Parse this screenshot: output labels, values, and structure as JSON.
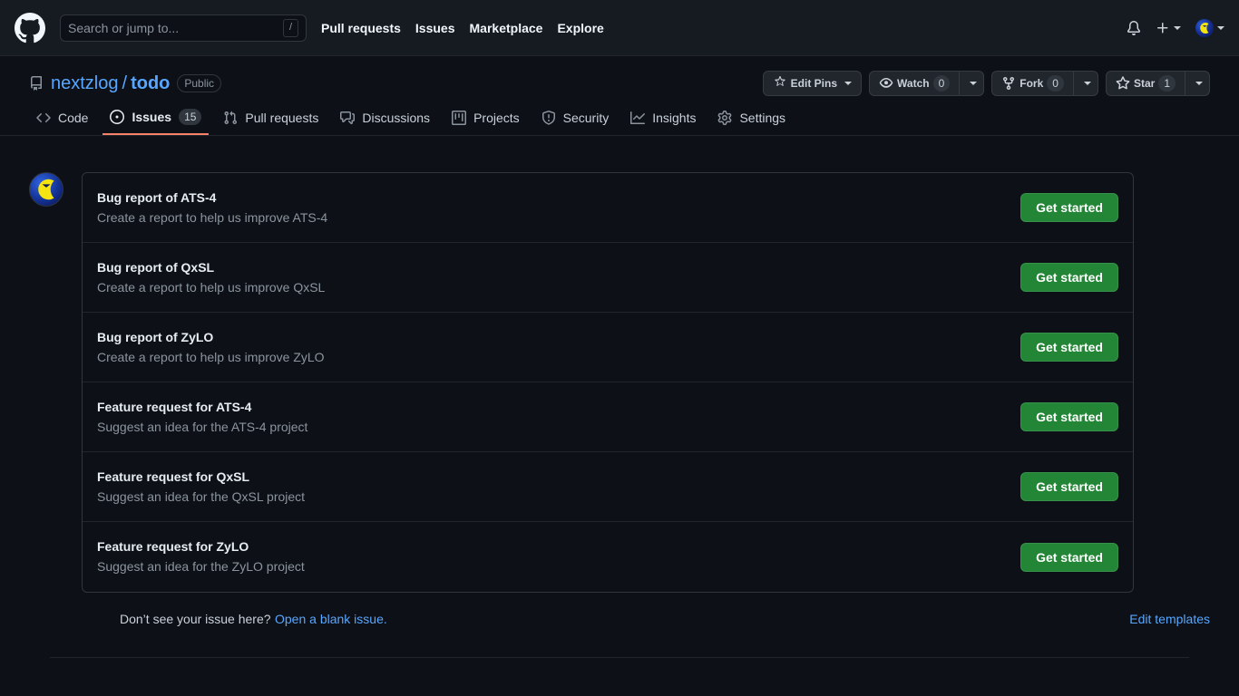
{
  "header": {
    "logo_icon": "github-mark-icon",
    "search": {
      "placeholder": "Search or jump to...",
      "value": "",
      "shortcut_key": "/"
    },
    "nav": [
      {
        "label": "Pull requests",
        "name": "nav-pull-requests"
      },
      {
        "label": "Issues",
        "name": "nav-issues"
      },
      {
        "label": "Marketplace",
        "name": "nav-marketplace"
      },
      {
        "label": "Explore",
        "name": "nav-explore"
      }
    ],
    "notifications_icon": "bell-icon",
    "create_new_icon": "plus-icon",
    "account_icon": "user-avatar"
  },
  "repo": {
    "icon": "repo-icon",
    "owner": "nextzlog",
    "separator": "/",
    "name": "todo",
    "visibility": "Public",
    "actions": {
      "edit_pins": {
        "label": "Edit Pins",
        "icon": "pin-star-icon"
      },
      "watch": {
        "label": "Watch",
        "count": "0",
        "icon": "eye-icon"
      },
      "fork": {
        "label": "Fork",
        "count": "0",
        "icon": "fork-icon"
      },
      "star": {
        "label": "Star",
        "count": "1",
        "icon": "star-icon"
      }
    }
  },
  "tabs": [
    {
      "label": "Code",
      "icon": "code-icon",
      "count": null,
      "active": false
    },
    {
      "label": "Issues",
      "icon": "issue-opened-icon",
      "count": "15",
      "active": true
    },
    {
      "label": "Pull requests",
      "icon": "git-pull-request-icon",
      "count": null,
      "active": false
    },
    {
      "label": "Discussions",
      "icon": "comment-discussion-icon",
      "count": null,
      "active": false
    },
    {
      "label": "Projects",
      "icon": "project-icon",
      "count": null,
      "active": false
    },
    {
      "label": "Security",
      "icon": "shield-icon",
      "count": null,
      "active": false
    },
    {
      "label": "Insights",
      "icon": "graph-icon",
      "count": null,
      "active": false
    },
    {
      "label": "Settings",
      "icon": "gear-icon",
      "count": null,
      "active": false
    }
  ],
  "main": {
    "org_avatar_icon": "crescent-moon-antenna-avatar",
    "templates": [
      {
        "name": "Bug report of ATS-4",
        "about": "Create a report to help us improve ATS-4",
        "button": "Get started"
      },
      {
        "name": "Bug report of QxSL",
        "about": "Create a report to help us improve QxSL",
        "button": "Get started"
      },
      {
        "name": "Bug report of ZyLO",
        "about": "Create a report to help us improve ZyLO",
        "button": "Get started"
      },
      {
        "name": "Feature request for ATS-4",
        "about": "Suggest an idea for the ATS-4 project",
        "button": "Get started"
      },
      {
        "name": "Feature request for QxSL",
        "about": "Suggest an idea for the QxSL project",
        "button": "Get started"
      },
      {
        "name": "Feature request for ZyLO",
        "about": "Suggest an idea for the ZyLO project",
        "button": "Get started"
      }
    ],
    "blank_issue_prompt": "Don’t see your issue here?",
    "blank_issue_link": "Open a blank issue.",
    "edit_templates_link": "Edit templates"
  },
  "colors": {
    "page_bg": "#0d1117",
    "header_bg": "#161b22",
    "border": "#30363d",
    "accent_link": "#58a6ff",
    "primary_button": "#238636",
    "active_tab_underline": "#f78166",
    "muted_text": "#8b949e"
  }
}
